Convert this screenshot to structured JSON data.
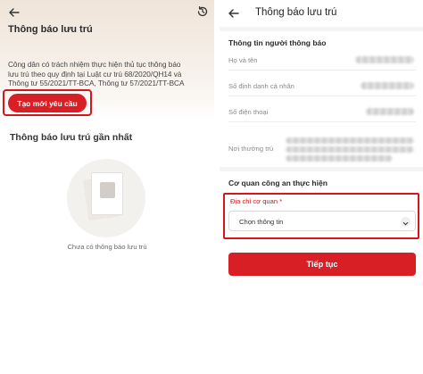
{
  "left": {
    "title": "Thông báo lưu trú",
    "description_lines": [
      "Công dân có trách nhiệm thực hiện thủ tục thông báo",
      "lưu trú theo quy định tại Luật cư trú 68/2020/QH14 và",
      "Thông tư 55/2021/TT-BCA, Thông tư 57/2021/TT-BCA"
    ],
    "create_button": "Tạo mới yêu cầu",
    "recent_title": "Thông báo lưu trú gần nhất",
    "empty_text": "Chưa có thông báo lưu trú",
    "icons": {
      "back": "back-arrow-icon",
      "history": "history-icon",
      "empty": "empty-document-icon"
    }
  },
  "right": {
    "title": "Thông báo lưu trú",
    "notifier_section": "Thông tin người thông báo",
    "fields": [
      {
        "label": "Họ và tên"
      },
      {
        "label": "Số định danh cá nhân"
      },
      {
        "label": "Số điện thoại"
      },
      {
        "label": "Nơi thường trú"
      }
    ],
    "agency_section": "Cơ quan công an thực hiện",
    "address_label": "Địa chỉ cơ quan *",
    "select_placeholder": "Chọn thông tin",
    "continue_button": "Tiếp tục",
    "icons": {
      "back": "back-arrow-icon",
      "chevron": "chevron-down-icon"
    }
  },
  "colors": {
    "accent": "#d81f26",
    "highlight": "#d6151e"
  }
}
